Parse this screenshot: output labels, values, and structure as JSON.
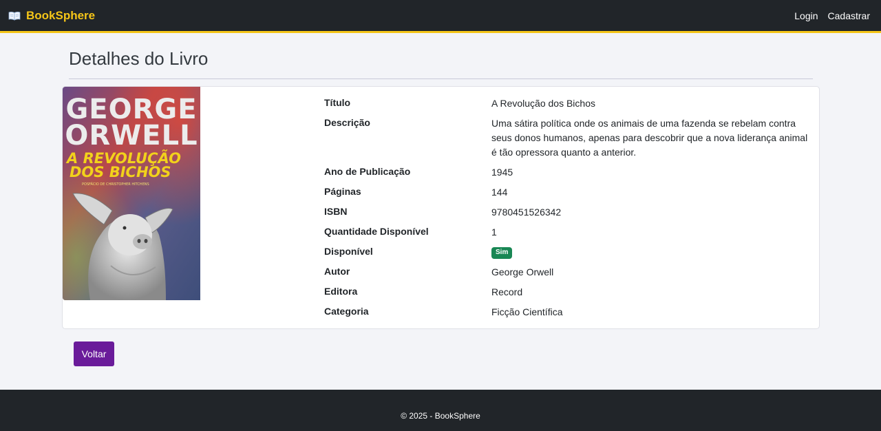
{
  "navbar": {
    "brand_icon": "open-book-icon",
    "brand_name": "BookSphere",
    "links": [
      {
        "label": "Login"
      },
      {
        "label": "Cadastrar"
      }
    ]
  },
  "page": {
    "title": "Detalhes do Livro"
  },
  "book": {
    "cover": {
      "author_text": "GEORGE ORWELL",
      "title_text": "A REVOLUÇÃO DOS BICHOS",
      "subtitle_text": "POSFÁCIO DE CHRISTOPHER HITCHENS"
    },
    "fields": [
      {
        "label": "Título",
        "value": "A Revolução dos Bichos"
      },
      {
        "label": "Descrição",
        "value": "Uma sátira política onde os animais de uma fazenda se rebelam contra seus donos humanos, apenas para descobrir que a nova liderança animal é tão opressora quanto a anterior."
      },
      {
        "label": "Ano de Publicação",
        "value": "1945"
      },
      {
        "label": "Páginas",
        "value": "144"
      },
      {
        "label": "ISBN",
        "value": "9780451526342"
      },
      {
        "label": "Quantidade Disponível",
        "value": "1"
      },
      {
        "label": "Disponível",
        "badge": "Sim"
      },
      {
        "label": "Autor",
        "value": "George Orwell"
      },
      {
        "label": "Editora",
        "value": "Record"
      },
      {
        "label": "Categoria",
        "value": "Ficção Científica"
      }
    ]
  },
  "actions": {
    "back_label": "Voltar"
  },
  "footer": {
    "text": "© 2025 - BookSphere"
  },
  "colors": {
    "navbar_bg": "#212529",
    "brand_accent": "#f5c518",
    "back_button": "#6a1b9a",
    "badge_success": "#198754"
  }
}
